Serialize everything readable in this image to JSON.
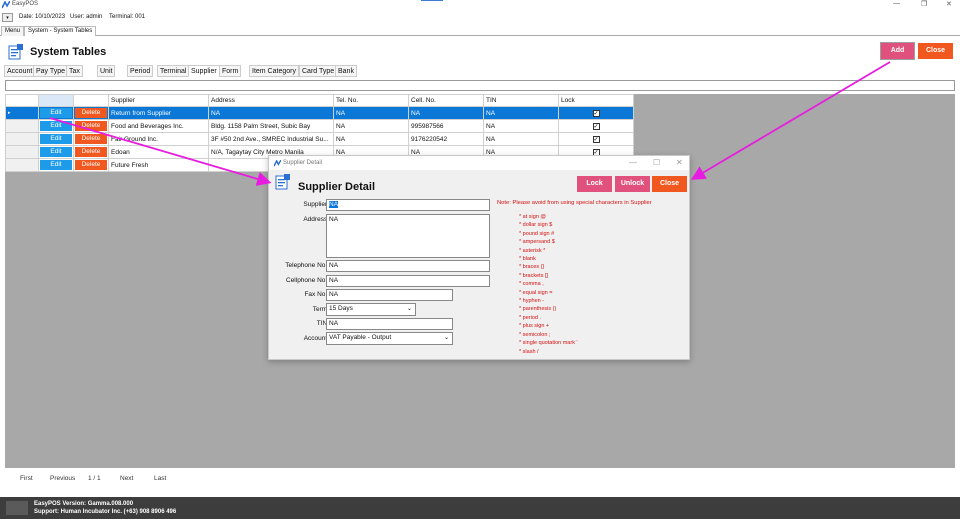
{
  "window": {
    "title": "EasyPOS"
  },
  "infobar": {
    "date": "Date: 10/10/2023",
    "user": "User: admin",
    "terminal": "Terminal: 001"
  },
  "main_tabs": [
    {
      "label": "Menu"
    },
    {
      "label": "System - System Tables"
    }
  ],
  "page": {
    "title": "System Tables",
    "add_label": "Add",
    "close_label": "Close"
  },
  "sub_tabs": [
    "Account",
    "Pay Type",
    "Tax",
    "Unit",
    "Period",
    "Terminal",
    "Supplier",
    "Form",
    "Item Category",
    "Card Type",
    "Bank"
  ],
  "grid": {
    "headers": {
      "supplier": "Supplier",
      "address": "Address",
      "tel": "Tel. No.",
      "cell": "Cell. No.",
      "tin": "TIN",
      "lock": "Lock"
    },
    "edit_label": "Edit",
    "delete_label": "Delete",
    "row_indicator": "▸",
    "rows": [
      {
        "supplier": "Return from Supplier",
        "address": "NA",
        "tel": "NA",
        "cell": "NA",
        "tin": "NA",
        "lock": "✓"
      },
      {
        "supplier": "Food and Beverages Inc.",
        "address": "Bldg. 1158 Palm Street, Subic Bay",
        "tel": "NA",
        "cell": "995987566",
        "tin": "NA",
        "lock": "✓"
      },
      {
        "supplier": "Fair Ground Inc.",
        "address": "3F #50 2nd Ave., SMREC Industrial Su...",
        "tel": "NA",
        "cell": "9176220542",
        "tin": "NA",
        "lock": "✓"
      },
      {
        "supplier": "Edoan",
        "address": "N/A, Tagaytay City Metro Manila",
        "tel": "NA",
        "cell": "NA",
        "tin": "NA",
        "lock": "✓"
      },
      {
        "supplier": "Future Fresh",
        "address": "",
        "tel": "",
        "cell": "",
        "tin": "",
        "lock": ""
      }
    ]
  },
  "pager": {
    "first": "First",
    "previous": "Previous",
    "page": "1 / 1",
    "next": "Next",
    "last": "Last"
  },
  "footer": {
    "version": "EasyPOS Version: Gamma.008.000",
    "support": "Support: Human Incubator Inc. (+63) 908 8906 496"
  },
  "dialog": {
    "window_title": "Supplier Detail",
    "title": "Supplier Detail",
    "lock_label": "Lock",
    "unlock_label": "Unlock",
    "close_label": "Close",
    "fields": {
      "supplier": {
        "label": "Supplier:",
        "value": "NA"
      },
      "address": {
        "label": "Address:",
        "value": "NA"
      },
      "telephone": {
        "label": "Telephone No.:",
        "value": "NA"
      },
      "cellphone": {
        "label": "Cellphone No.:",
        "value": "NA"
      },
      "fax": {
        "label": "Fax No.:",
        "value": "NA"
      },
      "term": {
        "label": "Term:",
        "value": "15 Days"
      },
      "tin": {
        "label": "TIN:",
        "value": "NA"
      },
      "account": {
        "label": "Account:",
        "value": "VAT Payable - Output"
      }
    },
    "note": "Note: Please avoid from using special characters in Supplier",
    "special_chars": [
      "* at sign @",
      "* dollar sign $",
      "* pound sign #",
      "* ampersand $",
      "* asterisk *",
      "* blank",
      "* braces {}",
      "* brackets []",
      "* comma ,",
      "* equal sign =",
      "* hyphen -",
      "* parenthesis ()",
      "* period .",
      "* plus sign +",
      "* semicolon ;",
      "* single quotation mark '",
      "* slash /"
    ]
  },
  "colors": {
    "accent_pink": "#e0527d",
    "accent_orange": "#f0581f",
    "selection_blue": "#0b78d7",
    "arrow": "#e81ce0"
  }
}
